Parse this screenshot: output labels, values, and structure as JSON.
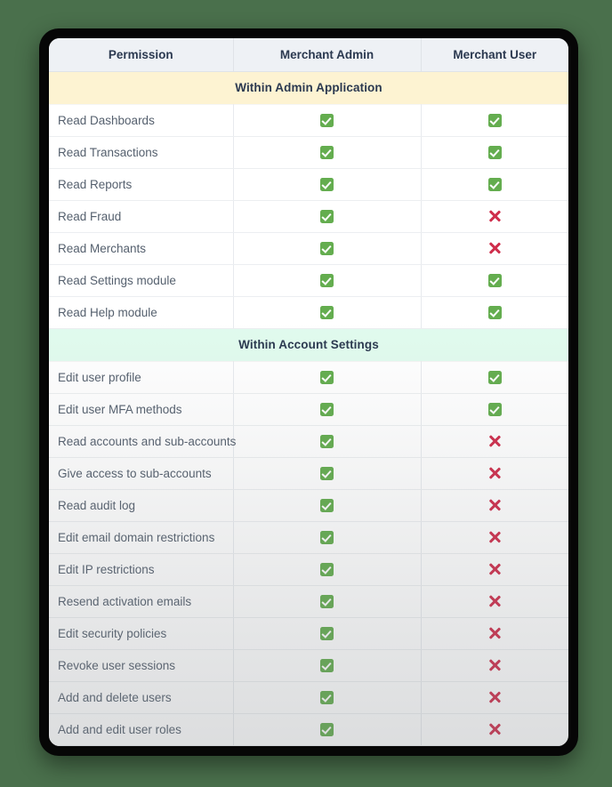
{
  "table": {
    "columns": [
      "Permission",
      "Merchant Admin",
      "Merchant User"
    ],
    "icons": {
      "yes": "check-green-icon",
      "no": "cross-red-icon"
    },
    "colors": {
      "page_background": "#4a704c",
      "frame": "#060606",
      "sheet": "#ffffff",
      "header_background": "#eef1f5",
      "header_text": "#2b3950",
      "row_text": "#55606e",
      "section_admin_background": "#fdf3d2",
      "section_account_background": "#e1fbee",
      "yes_green": "#64ad4f",
      "no_red": "#cf2e4c",
      "row_divider": "#eceef1"
    },
    "sections": [
      {
        "title": "Within Admin Application",
        "style": "admin",
        "rows": [
          {
            "permission": "Read Dashboards",
            "merchant_admin": "yes",
            "merchant_user": "yes"
          },
          {
            "permission": "Read Transactions",
            "merchant_admin": "yes",
            "merchant_user": "yes"
          },
          {
            "permission": "Read Reports",
            "merchant_admin": "yes",
            "merchant_user": "yes"
          },
          {
            "permission": "Read Fraud",
            "merchant_admin": "yes",
            "merchant_user": "no"
          },
          {
            "permission": "Read Merchants",
            "merchant_admin": "yes",
            "merchant_user": "no"
          },
          {
            "permission": "Read Settings module",
            "merchant_admin": "yes",
            "merchant_user": "yes"
          },
          {
            "permission": "Read Help module",
            "merchant_admin": "yes",
            "merchant_user": "yes"
          }
        ]
      },
      {
        "title": "Within Account Settings",
        "style": "account",
        "rows": [
          {
            "permission": "Edit user profile",
            "merchant_admin": "yes",
            "merchant_user": "yes"
          },
          {
            "permission": "Edit user MFA methods",
            "merchant_admin": "yes",
            "merchant_user": "yes"
          },
          {
            "permission": "Read accounts and sub-accounts",
            "merchant_admin": "yes",
            "merchant_user": "no"
          },
          {
            "permission": "Give access to sub-accounts",
            "merchant_admin": "yes",
            "merchant_user": "no"
          },
          {
            "permission": "Read audit log",
            "merchant_admin": "yes",
            "merchant_user": "no"
          },
          {
            "permission": "Edit email domain restrictions",
            "merchant_admin": "yes",
            "merchant_user": "no"
          },
          {
            "permission": "Edit IP restrictions",
            "merchant_admin": "yes",
            "merchant_user": "no"
          },
          {
            "permission": "Resend activation emails",
            "merchant_admin": "yes",
            "merchant_user": "no"
          },
          {
            "permission": "Edit security policies",
            "merchant_admin": "yes",
            "merchant_user": "no"
          },
          {
            "permission": "Revoke user sessions",
            "merchant_admin": "yes",
            "merchant_user": "no"
          },
          {
            "permission": "Add and delete users",
            "merchant_admin": "yes",
            "merchant_user": "no"
          },
          {
            "permission": "Add and edit user roles",
            "merchant_admin": "yes",
            "merchant_user": "no"
          }
        ]
      }
    ]
  }
}
